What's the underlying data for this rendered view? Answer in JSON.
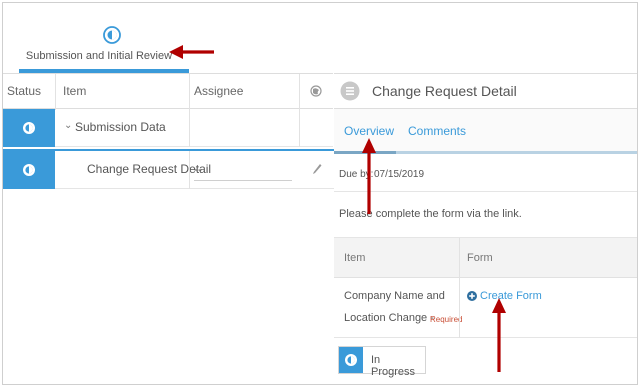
{
  "stage": {
    "label": "Submission and Initial Review"
  },
  "left_table": {
    "headers": {
      "status": "Status",
      "item": "Item",
      "assignee": "Assignee"
    },
    "rows": [
      {
        "item": "Submission Data",
        "assignee": ""
      },
      {
        "item": "Change Request Detail",
        "assignee": "--"
      }
    ],
    "colors": {
      "accent": "#3a9ad9"
    }
  },
  "right_pane": {
    "title": "Change Request Detail",
    "tabs": [
      {
        "label": "Overview"
      },
      {
        "label": "Comments"
      }
    ],
    "due_label": "Due by:",
    "due_value": "07/15/2019",
    "message": "Please complete the form via the link.",
    "form_table": {
      "headers": {
        "item": "Item",
        "form": "Form"
      },
      "row": {
        "item_line1": "Company Name and",
        "item_line2": "Location Change -",
        "required_label": "Required",
        "form_link": "Create Form"
      }
    },
    "status_chip": "In Progress"
  },
  "icons": {
    "stage": "stage-status-icon",
    "row_status": "status-clock-icon",
    "edit": "pencil-icon",
    "globe": "globe-icon",
    "detail": "detail-icon",
    "plus": "plus-circle-icon",
    "chevron": "chevron-down-icon"
  }
}
